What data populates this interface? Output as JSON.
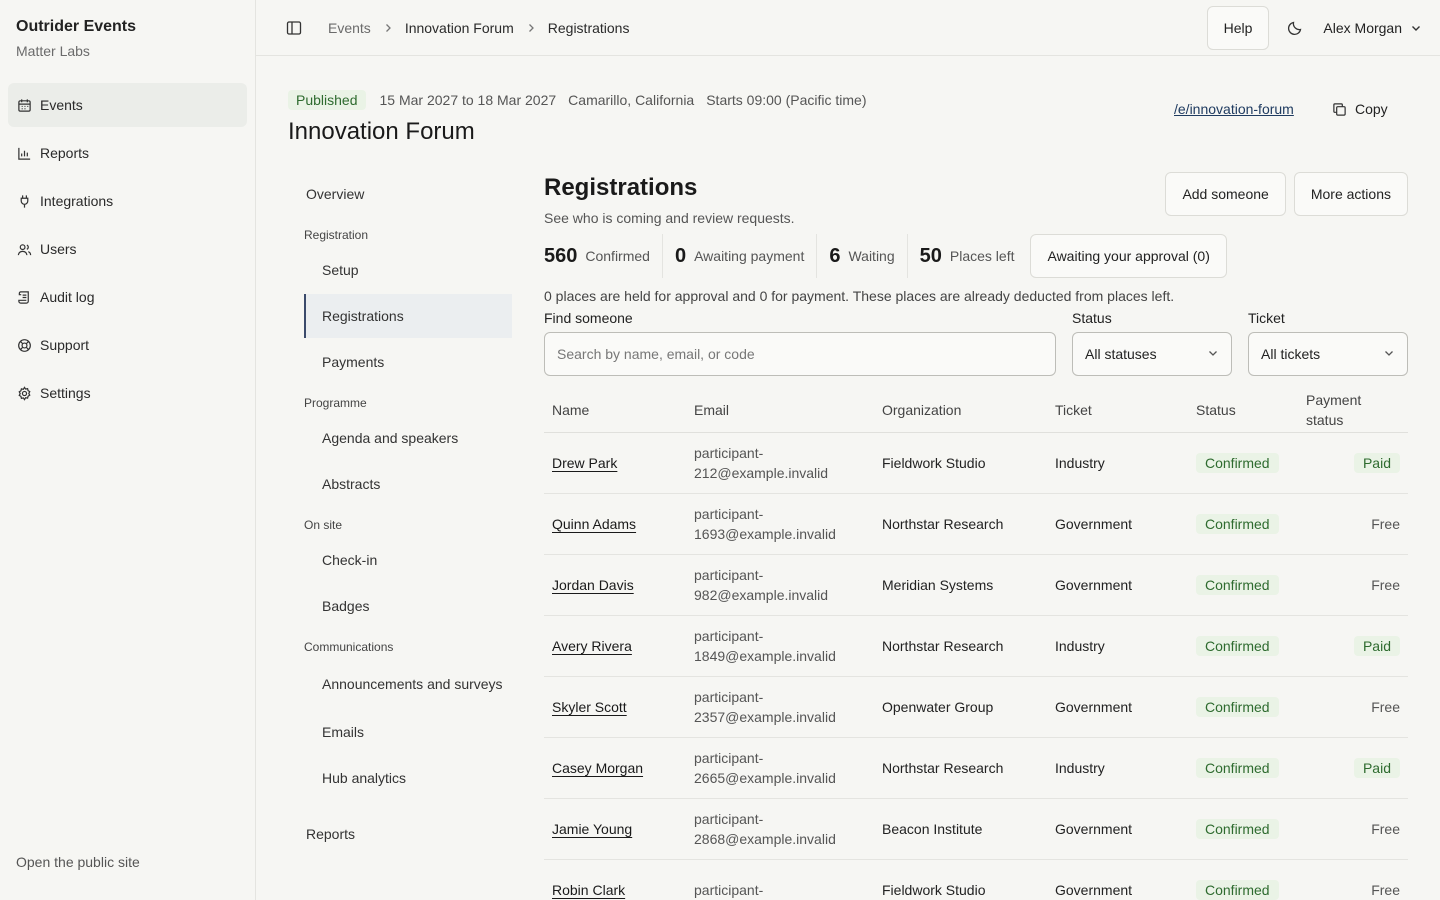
{
  "brand": {
    "title": "Outrider Events",
    "org": "Matter Labs"
  },
  "sidebar": {
    "items": [
      {
        "label": "Events",
        "icon": "calendar-icon",
        "active": true
      },
      {
        "label": "Reports",
        "icon": "bar-chart-icon"
      },
      {
        "label": "Integrations",
        "icon": "plug-icon"
      },
      {
        "label": "Users",
        "icon": "users-icon"
      },
      {
        "label": "Audit log",
        "icon": "scroll-icon"
      },
      {
        "label": "Support",
        "icon": "lifebuoy-icon"
      },
      {
        "label": "Settings",
        "icon": "gear-icon"
      }
    ],
    "footer": "Open the public site"
  },
  "topbar": {
    "breadcrumbs": [
      "Events",
      "Innovation Forum",
      "Registrations"
    ],
    "help_label": "Help",
    "user_name": "Alex Morgan"
  },
  "event": {
    "status": "Published",
    "dates": "15 Mar 2027 to 18 Mar 2027",
    "location": "Camarillo, California",
    "start": "Starts 09:00 (Pacific time)",
    "title": "Innovation Forum",
    "public_link": "/e/innovation-forum",
    "copy_label": "Copy"
  },
  "subnav": {
    "overview": "Overview",
    "groups": [
      {
        "label": "Registration",
        "items": [
          "Setup",
          "Registrations",
          "Payments"
        ]
      },
      {
        "label": "Programme",
        "items": [
          "Agenda and speakers",
          "Abstracts"
        ]
      },
      {
        "label": "On site",
        "items": [
          "Check-in",
          "Badges"
        ]
      },
      {
        "label": "Communications",
        "items": [
          "Announcements and surveys",
          "Emails",
          "Hub analytics"
        ]
      }
    ],
    "reports": "Reports",
    "active": "Registrations"
  },
  "registrations": {
    "title": "Registrations",
    "subtitle": "See who is coming and review requests.",
    "add_label": "Add someone",
    "more_label": "More actions",
    "stats": [
      {
        "num": "560",
        "label": "Confirmed"
      },
      {
        "num": "0",
        "label": "Awaiting payment"
      },
      {
        "num": "6",
        "label": "Waiting"
      },
      {
        "num": "50",
        "label": "Places left"
      }
    ],
    "approval_label": "Awaiting your approval (0)",
    "note": "0 places are held for approval and 0 for payment. These places are already deducted from places left.",
    "find_label": "Find someone",
    "search_placeholder": "Search by name, email, or code",
    "status_label": "Status",
    "status_value": "All statuses",
    "ticket_label": "Ticket",
    "ticket_value": "All tickets",
    "columns": [
      "Name",
      "Email",
      "Organization",
      "Ticket",
      "Status",
      "Payment status"
    ],
    "rows": [
      {
        "name": "Drew Park",
        "email1": "participant-",
        "email2": "212@example.invalid",
        "org": "Fieldwork Studio",
        "ticket": "Industry",
        "status": "Confirmed",
        "payment": "Paid"
      },
      {
        "name": "Quinn Adams",
        "email1": "participant-",
        "email2": "1693@example.invalid",
        "org": "Northstar Research",
        "ticket": "Government",
        "status": "Confirmed",
        "payment": "Free"
      },
      {
        "name": "Jordan Davis",
        "email1": "participant-",
        "email2": "982@example.invalid",
        "org": "Meridian Systems",
        "ticket": "Government",
        "status": "Confirmed",
        "payment": "Free"
      },
      {
        "name": "Avery Rivera",
        "email1": "participant-",
        "email2": "1849@example.invalid",
        "org": "Northstar Research",
        "ticket": "Industry",
        "status": "Confirmed",
        "payment": "Paid"
      },
      {
        "name": "Skyler Scott",
        "email1": "participant-",
        "email2": "2357@example.invalid",
        "org": "Openwater Group",
        "ticket": "Government",
        "status": "Confirmed",
        "payment": "Free"
      },
      {
        "name": "Casey Morgan",
        "email1": "participant-",
        "email2": "2665@example.invalid",
        "org": "Northstar Research",
        "ticket": "Industry",
        "status": "Confirmed",
        "payment": "Paid"
      },
      {
        "name": "Jamie Young",
        "email1": "participant-",
        "email2": "2868@example.invalid",
        "org": "Beacon Institute",
        "ticket": "Government",
        "status": "Confirmed",
        "payment": "Free"
      },
      {
        "name": "Robin Clark",
        "email1": "participant-",
        "email2": "",
        "org": "Fieldwork Studio",
        "ticket": "Government",
        "status": "Confirmed",
        "payment": "Free"
      }
    ]
  }
}
